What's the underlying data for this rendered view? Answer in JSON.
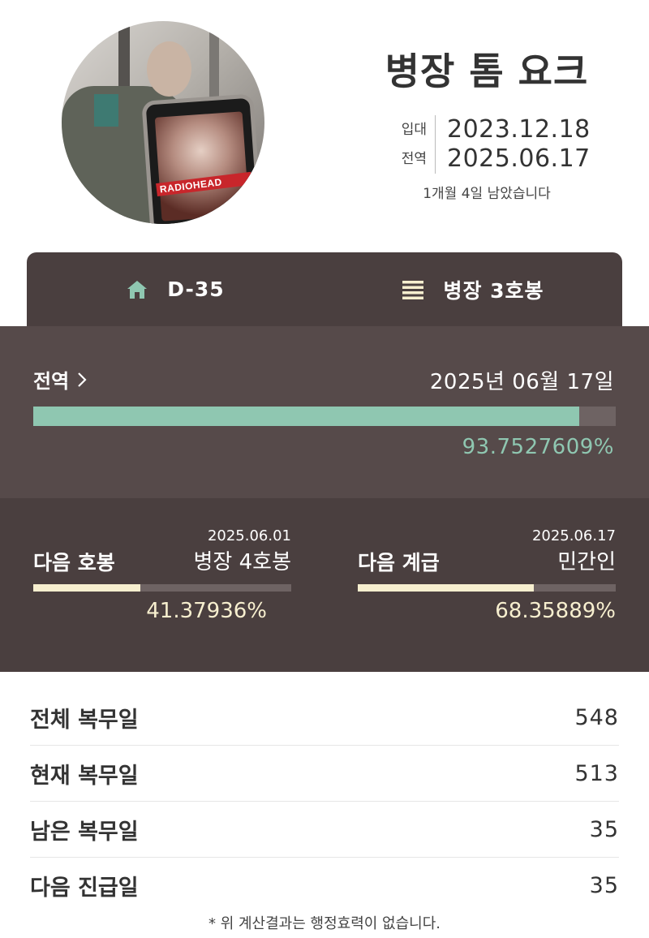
{
  "profile": {
    "rank_name": "병장 톰 요크",
    "enlist_label": "입대",
    "enlist_date": "2023.12.18",
    "discharge_label": "전역",
    "discharge_date": "2025.06.17",
    "remaining_text": "1개월 4일 남았습니다",
    "avatar_overlay_text": "RADIOHEAD"
  },
  "tabs": [
    {
      "icon": "home-icon",
      "label": "D-35"
    },
    {
      "icon": "list-icon",
      "label": "병장 3호봉"
    }
  ],
  "discharge": {
    "title": "전역",
    "date": "2025년 06월 17일",
    "progress_percent": 93.7527609,
    "percent_text": "93.7527609%"
  },
  "next": {
    "pay_step": {
      "label": "다음 호봉",
      "date": "2025.06.01",
      "value": "병장 4호봉",
      "progress_percent": 41.37936,
      "percent_text": "41.37936%"
    },
    "rank": {
      "label": "다음 계급",
      "date": "2025.06.17",
      "value": "민간인",
      "progress_percent": 68.35889,
      "percent_text": "68.35889%"
    }
  },
  "stats": [
    {
      "label": "전체 복무일",
      "value": "548"
    },
    {
      "label": "현재 복무일",
      "value": "513"
    },
    {
      "label": "남은 복무일",
      "value": "35"
    },
    {
      "label": "다음 진급일",
      "value": "35"
    }
  ],
  "disclaimer": "* 위 계산결과는 행정효력이 없습니다.",
  "colors": {
    "accent_green": "#8fc7b1",
    "accent_cream": "#f7efcf",
    "panel_dark": "#4a3f3f",
    "panel_mid": "#564a4a"
  }
}
